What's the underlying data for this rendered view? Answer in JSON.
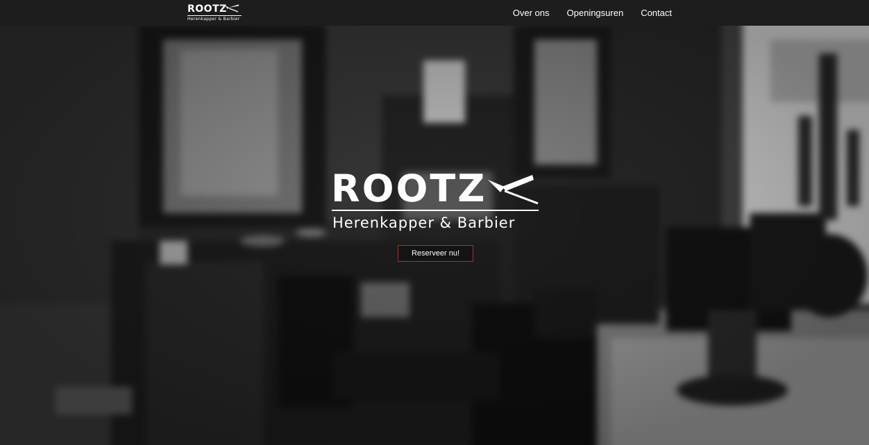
{
  "header": {
    "brand": {
      "word": "ROOTZ",
      "tagline": "Herenkapper & Barbier"
    },
    "nav": [
      {
        "label": "Over ons"
      },
      {
        "label": "Openingsuren"
      },
      {
        "label": "Contact"
      }
    ]
  },
  "hero": {
    "logo": {
      "word": "ROOTZ",
      "tagline": "Herenkapper & Barbier"
    },
    "cta_label": "Reserveer nu!"
  },
  "colors": {
    "nav_background": "#1d1d1d",
    "text": "#ffffff",
    "cta_border": "#c0262d"
  },
  "icons": {
    "logo_mark": "straight-razor-icon"
  }
}
